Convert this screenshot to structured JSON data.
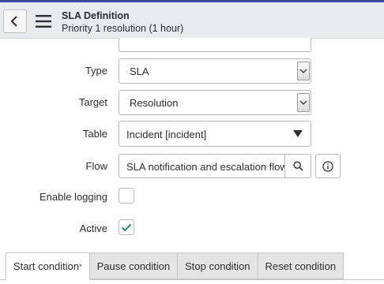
{
  "header": {
    "title": "SLA Definition",
    "subtitle": "Priority 1 resolution (1 hour)"
  },
  "form": {
    "type": {
      "label": "Type",
      "value": "SLA"
    },
    "target": {
      "label": "Target",
      "value": "Resolution"
    },
    "table": {
      "label": "Table",
      "value": "Incident [incident]"
    },
    "flow": {
      "label": "Flow",
      "value": "SLA notification and escalation flow"
    },
    "enable_logging": {
      "label": "Enable logging",
      "checked": false
    },
    "active": {
      "label": "Active",
      "checked": true
    }
  },
  "tabs": [
    {
      "label": "Start condition",
      "required_mark": "*",
      "active": true
    },
    {
      "label": "Pause condition",
      "active": false
    },
    {
      "label": "Stop condition",
      "active": false
    },
    {
      "label": "Reset condition",
      "active": false
    }
  ],
  "colors": {
    "top_strip": "#3b4a9e",
    "header_bg": "#e8ebed",
    "check_green": "#278a70"
  }
}
